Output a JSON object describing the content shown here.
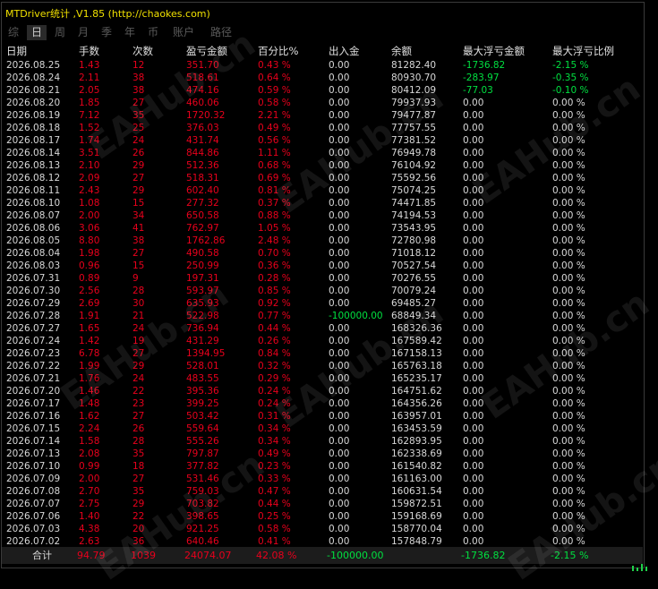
{
  "title": "MTDriver统计 ,V1.85 (http://chaokes.com)",
  "tabs": [
    {
      "label": "综",
      "active": false
    },
    {
      "label": "日",
      "active": true
    },
    {
      "label": "周",
      "active": false
    },
    {
      "label": "月",
      "active": false
    },
    {
      "label": "季",
      "active": false
    },
    {
      "label": "年",
      "active": false
    },
    {
      "label": "币",
      "active": false
    },
    {
      "label": "账户",
      "active": false
    },
    {
      "label": "路径",
      "active": false
    }
  ],
  "headers": [
    "日期",
    "手数",
    "次数",
    "盈亏金额",
    "百分比%",
    "出入金",
    "余额",
    "最大浮亏金额",
    "最大浮亏比例"
  ],
  "rows": [
    [
      "2026.08.25",
      "1.43",
      "12",
      "351.70",
      "0.43 %",
      "0.00",
      "81282.40",
      "-1736.82",
      "-2.15 %"
    ],
    [
      "2026.08.24",
      "2.11",
      "38",
      "518.61",
      "0.64 %",
      "0.00",
      "80930.70",
      "-283.97",
      "-0.35 %"
    ],
    [
      "2026.08.21",
      "2.05",
      "38",
      "474.16",
      "0.59 %",
      "0.00",
      "80412.09",
      "-77.03",
      "-0.10 %"
    ],
    [
      "2026.08.20",
      "1.85",
      "27",
      "460.06",
      "0.58 %",
      "0.00",
      "79937.93",
      "0.00",
      "0.00 %"
    ],
    [
      "2026.08.19",
      "7.12",
      "35",
      "1720.32",
      "2.21 %",
      "0.00",
      "79477.87",
      "0.00",
      "0.00 %"
    ],
    [
      "2026.08.18",
      "1.52",
      "25",
      "376.03",
      "0.49 %",
      "0.00",
      "77757.55",
      "0.00",
      "0.00 %"
    ],
    [
      "2026.08.17",
      "1.74",
      "24",
      "431.74",
      "0.56 %",
      "0.00",
      "77381.52",
      "0.00",
      "0.00 %"
    ],
    [
      "2026.08.14",
      "3.51",
      "26",
      "844.86",
      "1.11 %",
      "0.00",
      "76949.78",
      "0.00",
      "0.00 %"
    ],
    [
      "2026.08.13",
      "2.10",
      "29",
      "512.36",
      "0.68 %",
      "0.00",
      "76104.92",
      "0.00",
      "0.00 %"
    ],
    [
      "2026.08.12",
      "2.09",
      "27",
      "518.31",
      "0.69 %",
      "0.00",
      "75592.56",
      "0.00",
      "0.00 %"
    ],
    [
      "2026.08.11",
      "2.43",
      "29",
      "602.40",
      "0.81 %",
      "0.00",
      "75074.25",
      "0.00",
      "0.00 %"
    ],
    [
      "2026.08.10",
      "1.08",
      "15",
      "277.32",
      "0.37 %",
      "0.00",
      "74471.85",
      "0.00",
      "0.00 %"
    ],
    [
      "2026.08.07",
      "2.00",
      "34",
      "650.58",
      "0.88 %",
      "0.00",
      "74194.53",
      "0.00",
      "0.00 %"
    ],
    [
      "2026.08.06",
      "3.06",
      "41",
      "762.97",
      "1.05 %",
      "0.00",
      "73543.95",
      "0.00",
      "0.00 %"
    ],
    [
      "2026.08.05",
      "8.80",
      "38",
      "1762.86",
      "2.48 %",
      "0.00",
      "72780.98",
      "0.00",
      "0.00 %"
    ],
    [
      "2026.08.04",
      "1.98",
      "27",
      "490.58",
      "0.70 %",
      "0.00",
      "71018.12",
      "0.00",
      "0.00 %"
    ],
    [
      "2026.08.03",
      "0.96",
      "15",
      "250.99",
      "0.36 %",
      "0.00",
      "70527.54",
      "0.00",
      "0.00 %"
    ],
    [
      "2026.07.31",
      "0.89",
      "9",
      "197.31",
      "0.28 %",
      "0.00",
      "70276.55",
      "0.00",
      "0.00 %"
    ],
    [
      "2026.07.30",
      "2.56",
      "28",
      "593.97",
      "0.85 %",
      "0.00",
      "70079.24",
      "0.00",
      "0.00 %"
    ],
    [
      "2026.07.29",
      "2.69",
      "30",
      "635.93",
      "0.92 %",
      "0.00",
      "69485.27",
      "0.00",
      "0.00 %"
    ],
    [
      "2026.07.28",
      "1.91",
      "21",
      "522.98",
      "0.77 %",
      "-100000.00",
      "68849.34",
      "0.00",
      "0.00 %"
    ],
    [
      "2026.07.27",
      "1.65",
      "24",
      "736.94",
      "0.44 %",
      "0.00",
      "168326.36",
      "0.00",
      "0.00 %"
    ],
    [
      "2026.07.24",
      "1.42",
      "19",
      "431.29",
      "0.26 %",
      "0.00",
      "167589.42",
      "0.00",
      "0.00 %"
    ],
    [
      "2026.07.23",
      "6.78",
      "27",
      "1394.95",
      "0.84 %",
      "0.00",
      "167158.13",
      "0.00",
      "0.00 %"
    ],
    [
      "2026.07.22",
      "1.99",
      "29",
      "528.01",
      "0.32 %",
      "0.00",
      "165763.18",
      "0.00",
      "0.00 %"
    ],
    [
      "2026.07.21",
      "1.76",
      "24",
      "483.55",
      "0.29 %",
      "0.00",
      "165235.17",
      "0.00",
      "0.00 %"
    ],
    [
      "2026.07.20",
      "1.46",
      "22",
      "395.36",
      "0.24 %",
      "0.00",
      "164751.62",
      "0.00",
      "0.00 %"
    ],
    [
      "2026.07.17",
      "1.48",
      "23",
      "399.25",
      "0.24 %",
      "0.00",
      "164356.26",
      "0.00",
      "0.00 %"
    ],
    [
      "2026.07.16",
      "1.62",
      "27",
      "503.42",
      "0.31 %",
      "0.00",
      "163957.01",
      "0.00",
      "0.00 %"
    ],
    [
      "2026.07.15",
      "2.24",
      "26",
      "559.64",
      "0.34 %",
      "0.00",
      "163453.59",
      "0.00",
      "0.00 %"
    ],
    [
      "2026.07.14",
      "1.58",
      "28",
      "555.26",
      "0.34 %",
      "0.00",
      "162893.95",
      "0.00",
      "0.00 %"
    ],
    [
      "2026.07.13",
      "2.08",
      "35",
      "797.87",
      "0.49 %",
      "0.00",
      "162338.69",
      "0.00",
      "0.00 %"
    ],
    [
      "2026.07.10",
      "0.99",
      "18",
      "377.82",
      "0.23 %",
      "0.00",
      "161540.82",
      "0.00",
      "0.00 %"
    ],
    [
      "2026.07.09",
      "2.00",
      "27",
      "531.46",
      "0.33 %",
      "0.00",
      "161163.00",
      "0.00",
      "0.00 %"
    ],
    [
      "2026.07.08",
      "2.70",
      "35",
      "759.03",
      "0.47 %",
      "0.00",
      "160631.54",
      "0.00",
      "0.00 %"
    ],
    [
      "2026.07.07",
      "2.75",
      "29",
      "703.82",
      "0.44 %",
      "0.00",
      "159872.51",
      "0.00",
      "0.00 %"
    ],
    [
      "2026.07.06",
      "1.40",
      "22",
      "398.65",
      "0.25 %",
      "0.00",
      "159168.69",
      "0.00",
      "0.00 %"
    ],
    [
      "2026.07.03",
      "4.38",
      "20",
      "921.25",
      "0.58 %",
      "0.00",
      "158770.04",
      "0.00",
      "0.00 %"
    ],
    [
      "2026.07.02",
      "2.63",
      "36",
      "640.46",
      "0.41 %",
      "0.00",
      "157848.79",
      "0.00",
      "0.00 %"
    ]
  ],
  "total": {
    "label": "合计",
    "lots": "94.79",
    "count": "1039",
    "pnl": "24074.07",
    "pct": "42.08 %",
    "inout": "-100000.00",
    "balance": "",
    "max_dd": "-1736.82",
    "max_dd_pct": "-2.15 %"
  },
  "watermark": "EAHub.cn",
  "colors": {
    "title": "#f0e000",
    "loss": "#e8001c",
    "gain": "#00e040",
    "background": "#000000"
  }
}
